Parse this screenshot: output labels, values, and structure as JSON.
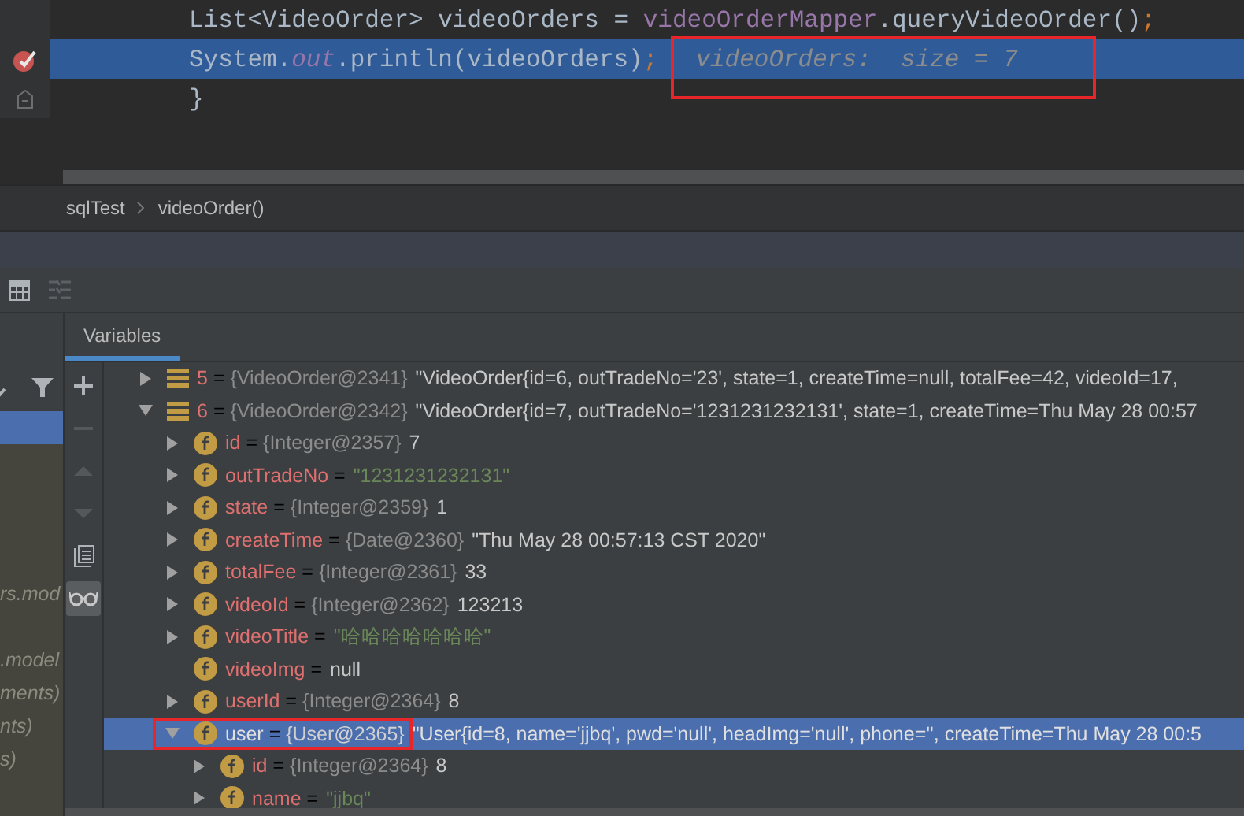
{
  "editor": {
    "lines": [
      {
        "highlighted": false,
        "breakpoint": false,
        "fold": false,
        "segments": [
          {
            "kind": "plain",
            "text": "List<VideoOrder> videoOrders = "
          },
          {
            "kind": "field",
            "text": "videoOrderMapper"
          },
          {
            "kind": "plain",
            "text": ".queryVideoOrder()"
          },
          {
            "kind": "punct",
            "text": ";"
          }
        ]
      },
      {
        "highlighted": true,
        "breakpoint": true,
        "fold": false,
        "segments": [
          {
            "kind": "plain",
            "text": "System."
          },
          {
            "kind": "static",
            "text": "out"
          },
          {
            "kind": "plain",
            "text": ".println(videoOrders)"
          },
          {
            "kind": "punct",
            "text": ";"
          },
          {
            "kind": "hint",
            "text": "videoOrders:  size = 7",
            "annotated": true
          }
        ]
      },
      {
        "highlighted": false,
        "breakpoint": false,
        "fold": true,
        "segments": [
          {
            "kind": "plain",
            "text": "}"
          }
        ]
      }
    ]
  },
  "breadcrumb": [
    "sqlTest",
    "videoOrder()"
  ],
  "tabs": [
    {
      "label": "Variables",
      "selected": true
    }
  ],
  "frames": [
    {
      "selected": true
    },
    {
      "text": "rs.mod",
      "selected": false
    },
    {
      "text": ".model",
      "selected": false
    },
    {
      "text": "ments)",
      "selected": false
    },
    {
      "text": "nts)",
      "selected": false
    },
    {
      "text": "s)",
      "selected": false
    }
  ],
  "variables": [
    {
      "kind": "list",
      "name": "5",
      "operator": "=",
      "type": "{VideoOrder@2341}",
      "value": {
        "kind": "plain",
        "text": "\"VideoOrder{id=6, outTradeNo='23', state=1, createTime=null, totalFee=42, videoId=17, "
      },
      "expanded": false,
      "selected": false,
      "annotated": false
    },
    {
      "kind": "list",
      "name": "6",
      "operator": "=",
      "type": "{VideoOrder@2342}",
      "value": {
        "kind": "plain",
        "text": "\"VideoOrder{id=7, outTradeNo='1231231232131', state=1, createTime=Thu May 28 00:57"
      },
      "expanded": true,
      "selected": false,
      "annotated": false,
      "children": [
        {
          "kind": "field",
          "name": "id",
          "operator": "=",
          "type": "{Integer@2357}",
          "value": {
            "kind": "plain",
            "text": "7"
          },
          "expanded": false,
          "selected": false,
          "annotated": false
        },
        {
          "kind": "field",
          "name": "outTradeNo",
          "operator": "=",
          "value": {
            "kind": "string",
            "text": "\"1231231232131\""
          },
          "expanded": false,
          "selected": false,
          "annotated": false
        },
        {
          "kind": "field",
          "name": "state",
          "operator": "=",
          "type": "{Integer@2359}",
          "value": {
            "kind": "plain",
            "text": "1"
          },
          "expanded": false,
          "selected": false,
          "annotated": false
        },
        {
          "kind": "field",
          "name": "createTime",
          "operator": "=",
          "type": "{Date@2360}",
          "value": {
            "kind": "plain",
            "text": "\"Thu May 28 00:57:13 CST 2020\""
          },
          "expanded": false,
          "selected": false,
          "annotated": false
        },
        {
          "kind": "field",
          "name": "totalFee",
          "operator": "=",
          "type": "{Integer@2361}",
          "value": {
            "kind": "plain",
            "text": "33"
          },
          "expanded": false,
          "selected": false,
          "annotated": false
        },
        {
          "kind": "field",
          "name": "videoId",
          "operator": "=",
          "type": "{Integer@2362}",
          "value": {
            "kind": "plain",
            "text": "123213"
          },
          "expanded": false,
          "selected": false,
          "annotated": false
        },
        {
          "kind": "field",
          "name": "videoTitle",
          "operator": "=",
          "value": {
            "kind": "string",
            "text": "\"哈哈哈哈哈哈哈\""
          },
          "expanded": false,
          "selected": false,
          "annotated": false
        },
        {
          "kind": "field",
          "name": "videoImg",
          "operator": "=",
          "value": {
            "kind": "plain",
            "text": "null"
          },
          "selected": false,
          "annotated": false
        },
        {
          "kind": "field",
          "name": "userId",
          "operator": "=",
          "type": "{Integer@2364}",
          "value": {
            "kind": "plain",
            "text": "8"
          },
          "expanded": false,
          "selected": false,
          "annotated": false
        },
        {
          "kind": "field",
          "name": "user",
          "operator": "=",
          "type": "{User@2365}",
          "value": {
            "kind": "plain",
            "text": "\"User{id=8, name='jjbq', pwd='null', headImg='null', phone='', createTime=Thu May 28 00:5"
          },
          "expanded": true,
          "selected": true,
          "annotated": true,
          "children": [
            {
              "kind": "field",
              "name": "id",
              "operator": "=",
              "type": "{Integer@2364}",
              "value": {
                "kind": "plain",
                "text": "8"
              },
              "expanded": false,
              "selected": false,
              "annotated": false
            },
            {
              "kind": "field",
              "name": "name",
              "operator": "=",
              "value": {
                "kind": "string",
                "text": "\"jjbq\""
              },
              "expanded": false,
              "selected": false,
              "annotated": false
            }
          ]
        }
      ]
    }
  ]
}
